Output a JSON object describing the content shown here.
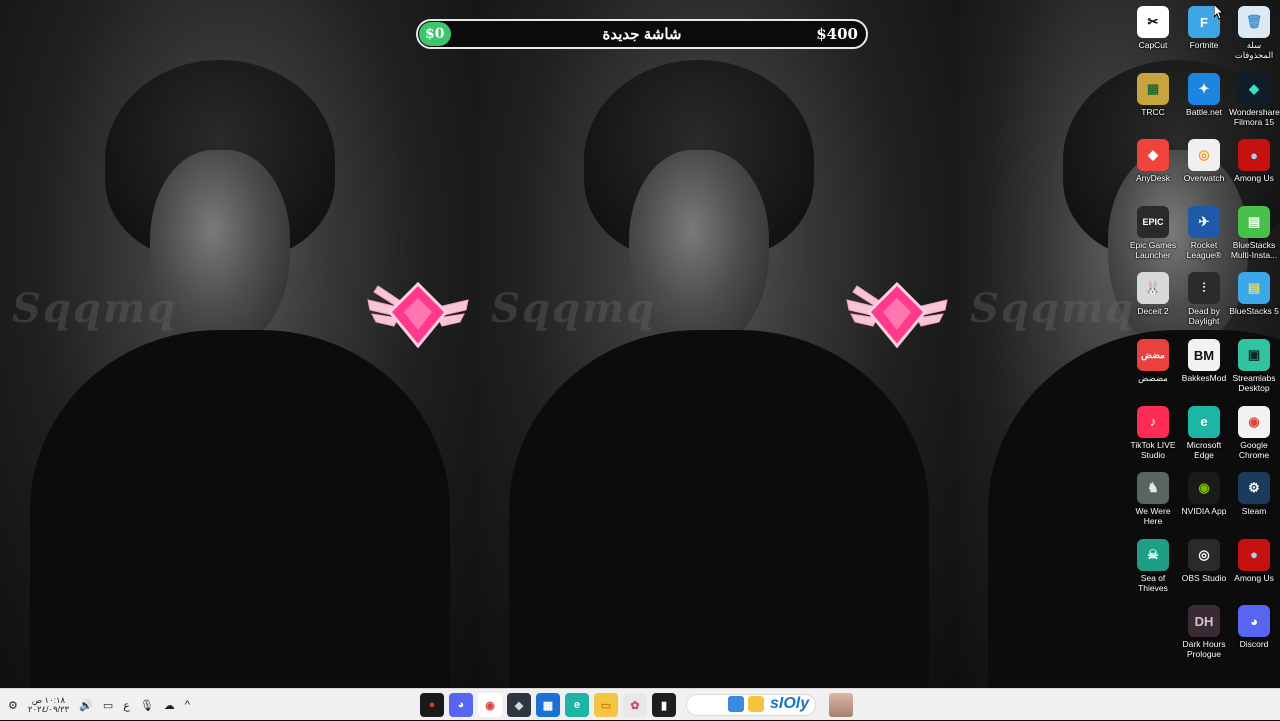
{
  "goal": {
    "start": "$0",
    "title": "شاشة جديدة",
    "end": "$400",
    "progress_fraction": 0,
    "fill_color": "#3ec46d"
  },
  "wallpaper": {
    "watermark": "Sqqmq"
  },
  "desktop_icons": [
    {
      "label": "CapCut",
      "icon": "capcut-icon",
      "color": "#ffffff",
      "glyph": "✂",
      "glyph_color": "#000000",
      "col": 0,
      "row": 0,
      "shortcut": false
    },
    {
      "label": "Fortnite",
      "icon": "fortnite-icon",
      "color": "#3fa6e6",
      "glyph": "F",
      "glyph_color": "#ffffff",
      "col": 1,
      "row": 0,
      "shortcut": true
    },
    {
      "label": "سلة المحذوفات",
      "icon": "recycle-bin-icon",
      "color": "#dbe9f5",
      "glyph": "🗑",
      "glyph_color": "#4a90c8",
      "col": 2,
      "row": 0,
      "shortcut": false
    },
    {
      "label": "TRCC",
      "icon": "trcc-icon",
      "color": "#c8a440",
      "glyph": "▦",
      "glyph_color": "#2a6a2a",
      "col": 0,
      "row": 1,
      "shortcut": false
    },
    {
      "label": "Battle.net",
      "icon": "battle-net-icon",
      "color": "#1b86e0",
      "glyph": "✦",
      "glyph_color": "#ffffff",
      "col": 1,
      "row": 1,
      "shortcut": true
    },
    {
      "label": "Wondershare Filmora 15",
      "icon": "filmora-icon",
      "color": "#0f1d2a",
      "glyph": "◆",
      "glyph_color": "#35e0c4",
      "col": 2,
      "row": 1,
      "shortcut": false
    },
    {
      "label": "AnyDesk",
      "icon": "anydesk-icon",
      "color": "#ef443b",
      "glyph": "◆",
      "glyph_color": "#ffffff",
      "col": 0,
      "row": 2,
      "shortcut": false
    },
    {
      "label": "Overwatch",
      "icon": "overwatch-icon",
      "color": "#f0f0f0",
      "glyph": "◎",
      "glyph_color": "#f99e1a",
      "col": 1,
      "row": 2,
      "shortcut": true
    },
    {
      "label": "Among Us",
      "icon": "among-us-icon",
      "color": "#c51111",
      "glyph": "●",
      "glyph_color": "#9ad7ee",
      "col": 2,
      "row": 2,
      "shortcut": true
    },
    {
      "label": "Epic Games Launcher",
      "icon": "epic-games-icon",
      "color": "#2a2a2a",
      "glyph": "EPIC",
      "glyph_color": "#ffffff",
      "col": 0,
      "row": 3,
      "shortcut": true
    },
    {
      "label": "Rocket League®",
      "icon": "rocket-league-icon",
      "color": "#1e5aa8",
      "glyph": "✈",
      "glyph_color": "#ffffff",
      "col": 1,
      "row": 3,
      "shortcut": true
    },
    {
      "label": "BlueStacks Multi-Insta...",
      "icon": "bluestacks-multi-icon",
      "color": "#47c04a",
      "glyph": "▤",
      "glyph_color": "#ffffff",
      "col": 2,
      "row": 3,
      "shortcut": false
    },
    {
      "label": "Deceit 2",
      "icon": "deceit-icon",
      "color": "#d8d8d8",
      "glyph": "🐰",
      "glyph_color": "#444444",
      "col": 0,
      "row": 4,
      "shortcut": true
    },
    {
      "label": "Dead by Daylight",
      "icon": "dead-by-daylight-icon",
      "color": "#2b2b2b",
      "glyph": "⫶",
      "glyph_color": "#ffffff",
      "col": 1,
      "row": 4,
      "shortcut": true
    },
    {
      "label": "BlueStacks 5",
      "icon": "bluestacks-icon",
      "color": "#3ba7e8",
      "glyph": "▤",
      "glyph_color": "#f7d34a",
      "col": 2,
      "row": 4,
      "shortcut": false
    },
    {
      "label": "مضضض",
      "icon": "app-icon",
      "color": "#e8413e",
      "glyph": "مضض",
      "glyph_color": "#ffffff",
      "col": 0,
      "row": 5,
      "shortcut": false
    },
    {
      "label": "BakkesMod",
      "icon": "bakkesmod-icon",
      "color": "#f2f2f2",
      "glyph": "BM",
      "glyph_color": "#111111",
      "col": 1,
      "row": 5,
      "shortcut": true
    },
    {
      "label": "Streamlabs Desktop",
      "icon": "streamlabs-icon",
      "color": "#31c3a2",
      "glyph": "▣",
      "glyph_color": "#0b2b26",
      "col": 2,
      "row": 5,
      "shortcut": false
    },
    {
      "label": "TikTok LIVE Studio",
      "icon": "tiktok-live-icon",
      "color": "#fe2c55",
      "glyph": "♪",
      "glyph_color": "#ffffff",
      "col": 0,
      "row": 6,
      "shortcut": false
    },
    {
      "label": "Microsoft Edge",
      "icon": "edge-icon",
      "color": "#1db5a6",
      "glyph": "e",
      "glyph_color": "#ffffff",
      "col": 1,
      "row": 6,
      "shortcut": true
    },
    {
      "label": "Google Chrome",
      "icon": "chrome-icon",
      "color": "#f2f2f2",
      "glyph": "◉",
      "glyph_color": "#db4437",
      "col": 2,
      "row": 6,
      "shortcut": false
    },
    {
      "label": "We Were Here",
      "icon": "we-were-here-icon",
      "color": "#586560",
      "glyph": "♞",
      "glyph_color": "#e6e6e6",
      "col": 0,
      "row": 7,
      "shortcut": true
    },
    {
      "label": "NVIDIA App",
      "icon": "nvidia-icon",
      "color": "#1a1a1a",
      "glyph": "◉",
      "glyph_color": "#76b900",
      "col": 1,
      "row": 7,
      "shortcut": false
    },
    {
      "label": "Steam",
      "icon": "steam-icon",
      "color": "#1b3a5c",
      "glyph": "⚙",
      "glyph_color": "#ffffff",
      "col": 2,
      "row": 7,
      "shortcut": true
    },
    {
      "label": "Sea of Thieves",
      "icon": "sea-of-thieves-icon",
      "color": "#1e9e84",
      "glyph": "☠",
      "glyph_color": "#cfffee",
      "col": 0,
      "row": 8,
      "shortcut": true
    },
    {
      "label": "OBS Studio",
      "icon": "obs-icon",
      "color": "#2a2a2a",
      "glyph": "◎",
      "glyph_color": "#ffffff",
      "col": 1,
      "row": 8,
      "shortcut": false
    },
    {
      "label": "Among Us",
      "icon": "among-us-icon",
      "color": "#c51111",
      "glyph": "●",
      "glyph_color": "#9ad7ee",
      "col": 2,
      "row": 8,
      "shortcut": true
    },
    {
      "label": "Dark Hours Prologue",
      "icon": "dark-hours-icon",
      "color": "#3a2a33",
      "glyph": "DH",
      "glyph_color": "#d0c7cc",
      "col": 1,
      "row": 9,
      "shortcut": true
    },
    {
      "label": "Discord",
      "icon": "discord-icon",
      "color": "#5865f2",
      "glyph": "◕",
      "glyph_color": "#ffffff",
      "col": 2,
      "row": 9,
      "shortcut": false
    }
  ],
  "taskbar": {
    "clock_time": "١٠:١٨ ص",
    "clock_date": "٢٠٢٤/٠٩/٢٣",
    "language": "ع",
    "search_text": "sIOly",
    "apps": [
      {
        "name": "red-dot-app-icon",
        "color": "#1a1a1a",
        "glyph": "●",
        "glyph_color": "#e0392b"
      },
      {
        "name": "discord-taskbar-icon",
        "color": "#5865f2",
        "glyph": "◕",
        "glyph_color": "#ffffff"
      },
      {
        "name": "chrome-taskbar-icon",
        "color": "#ffffff",
        "glyph": "◉",
        "glyph_color": "#db4437"
      },
      {
        "name": "cube-app-icon",
        "color": "#2d3540",
        "glyph": "◆",
        "glyph_color": "#cfd6de"
      },
      {
        "name": "store-icon",
        "color": "#1c6fd4",
        "glyph": "▦",
        "glyph_color": "#ffffff"
      },
      {
        "name": "edge-taskbar-icon",
        "color": "#1db5a6",
        "glyph": "e",
        "glyph_color": "#ffffff"
      },
      {
        "name": "file-explorer-icon",
        "color": "#f5c542",
        "glyph": "▭",
        "glyph_color": "#c8860a"
      },
      {
        "name": "photos-icon",
        "color": "#e8e8e8",
        "glyph": "✿",
        "glyph_color": "#d0457c"
      },
      {
        "name": "terminal-icon",
        "color": "#1e1e1e",
        "glyph": "▮",
        "glyph_color": "#ffffff"
      }
    ]
  }
}
